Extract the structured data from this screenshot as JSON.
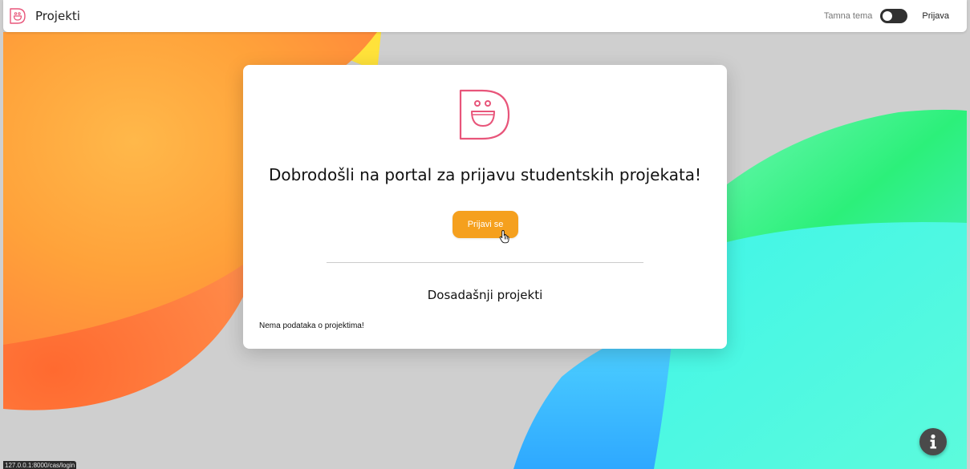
{
  "navbar": {
    "brand_title": "Projekti",
    "theme_label": "Tamna tema",
    "theme_dark_enabled": false,
    "login_label": "Prijava"
  },
  "card": {
    "heading": "Dobrodošli na portal za prijavu studentskih projekata!",
    "login_button_label": "Prijavi se",
    "projects_title": "Dosadašnji projekti",
    "empty_message": "Nema podataka o projektima!"
  },
  "status_bar": {
    "url": "127.0.0.1:8000/cas/login"
  },
  "colors": {
    "accent": "#f5a01e",
    "logo": "#e8557a",
    "background": "#cfcfcf"
  },
  "icons": {
    "brand": "smiley-d-logo-icon",
    "info": "info-icon",
    "cursor": "hand-pointer-icon"
  }
}
